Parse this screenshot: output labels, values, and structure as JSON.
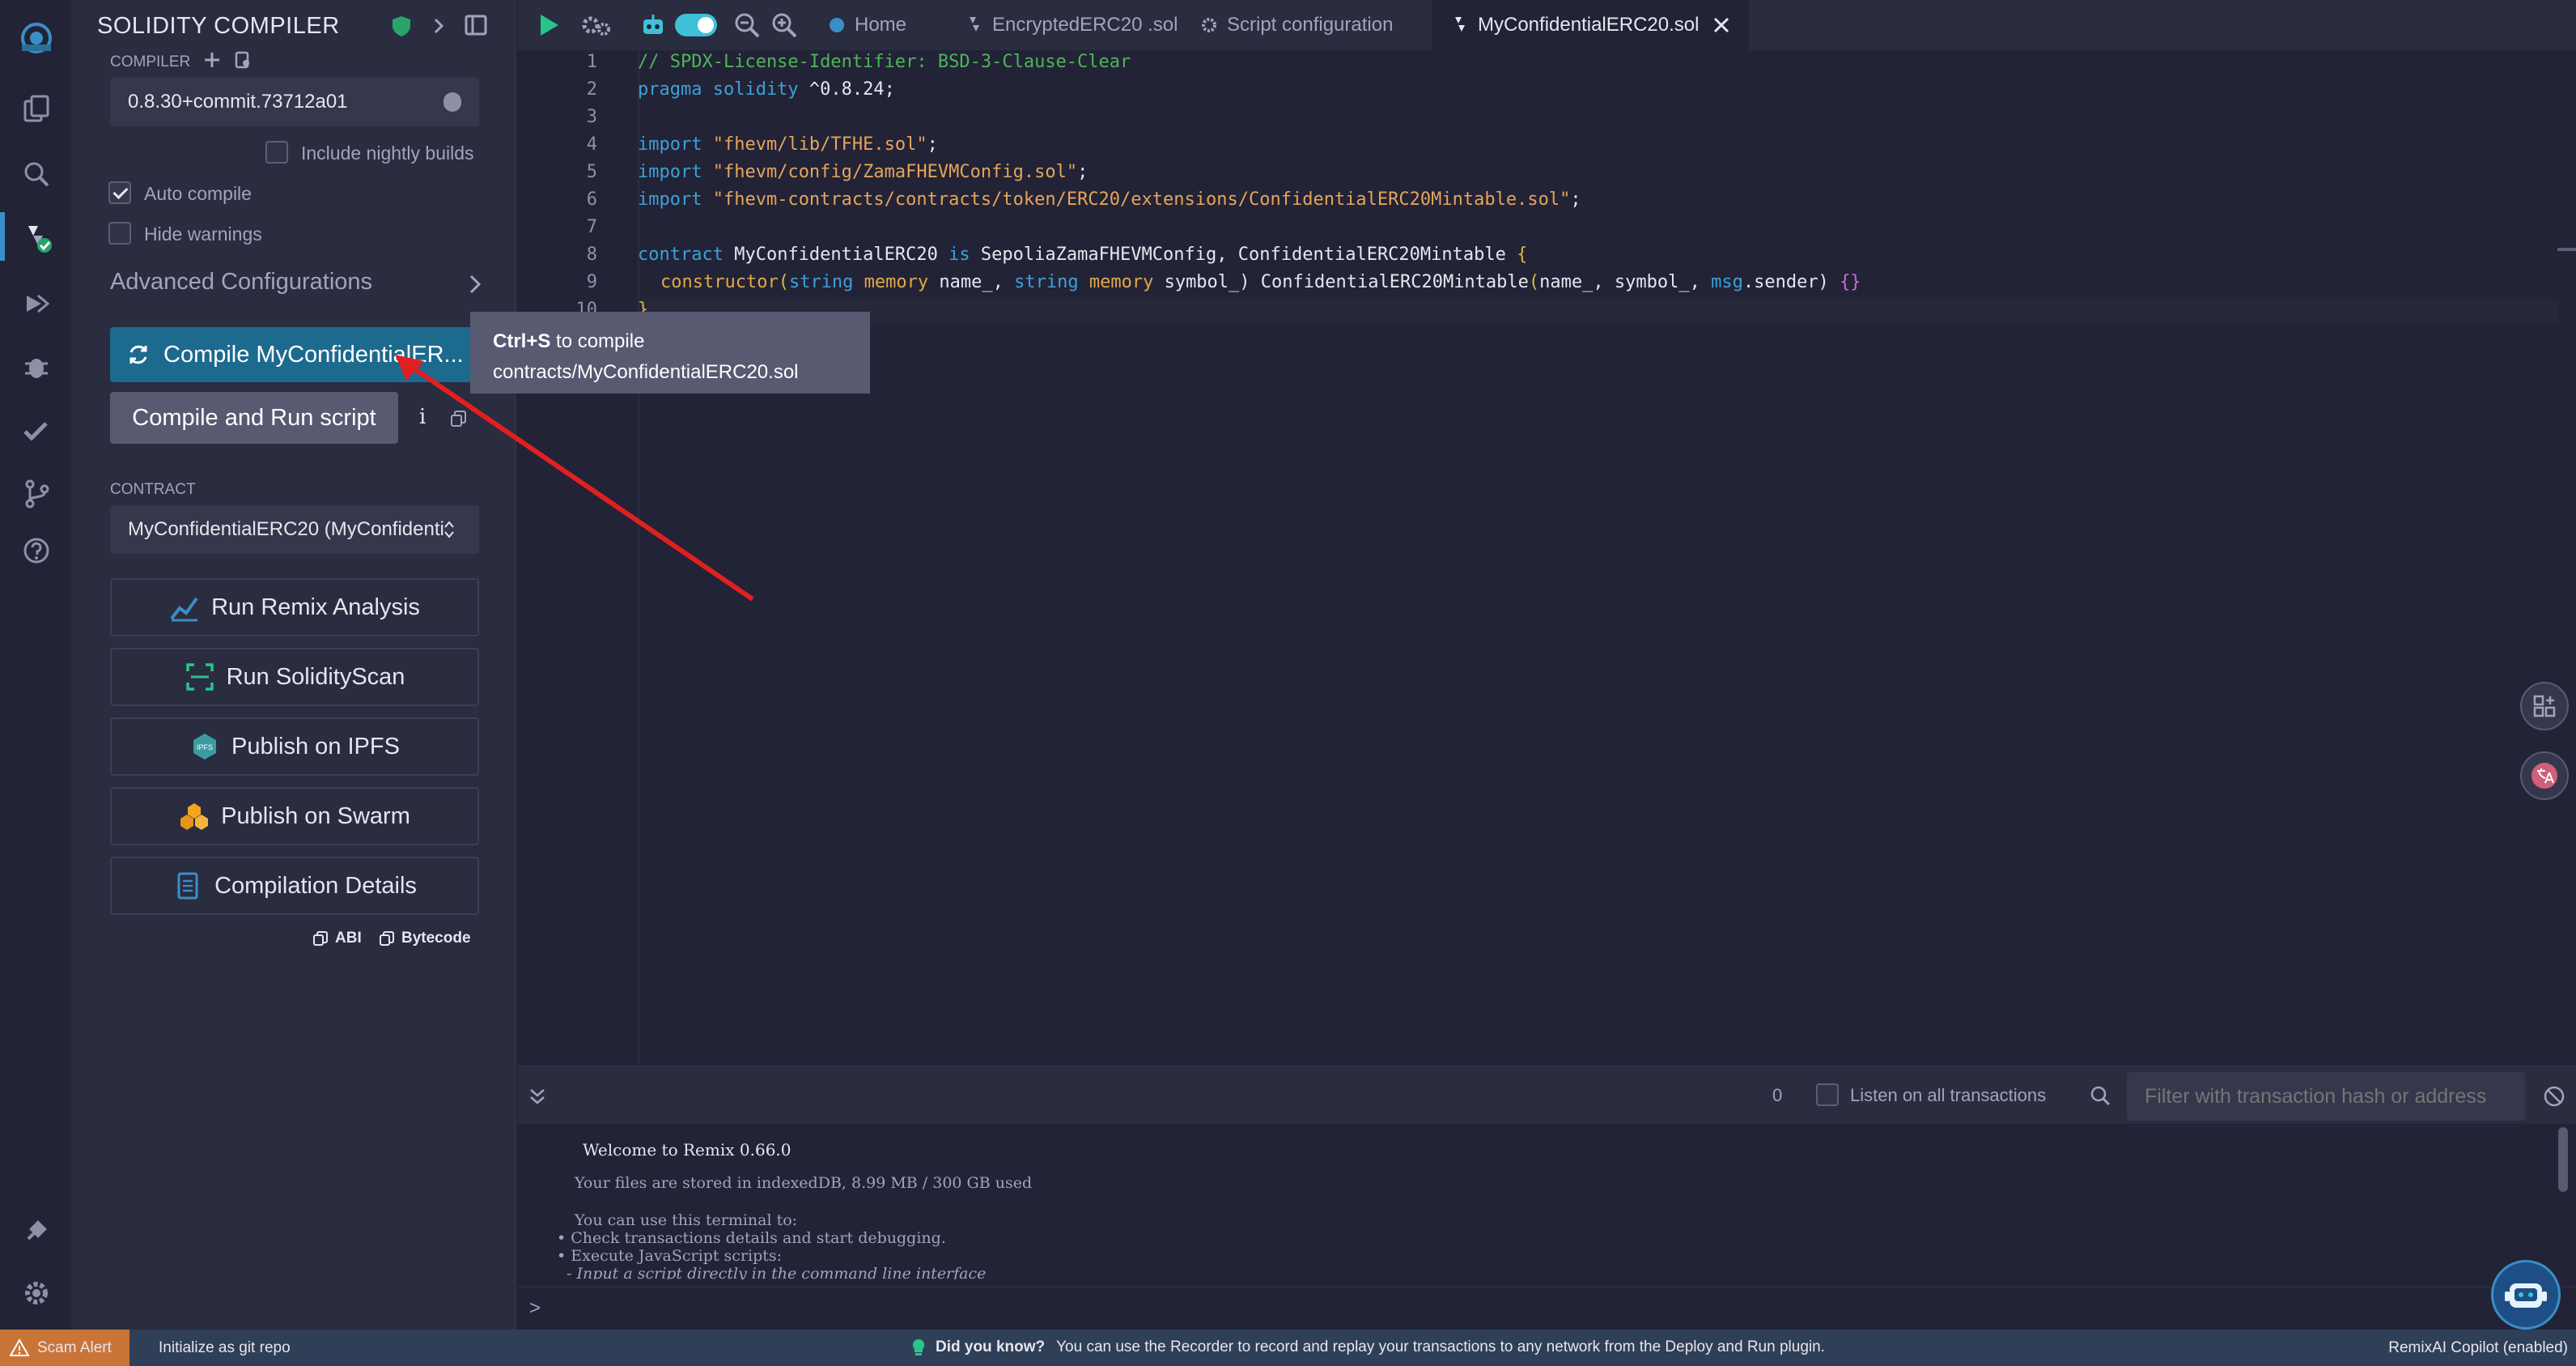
{
  "panel": {
    "title": "SOLIDITY COMPILER",
    "compiler_label": "COMPILER",
    "compiler_version": "0.8.30+commit.73712a01",
    "include_nightly": "Include nightly builds",
    "auto_compile": "Auto compile",
    "hide_warnings": "Hide warnings",
    "advanced": "Advanced Configurations",
    "compile_btn": "Compile MyConfidentialER...",
    "compile_run_btn": "Compile and Run script",
    "info_glyph": "i",
    "contract_label": "CONTRACT",
    "contract_value": "MyConfidentialERC20 (MyConfidenti",
    "run_analysis": "Run Remix Analysis",
    "run_scan": "Run SolidityScan",
    "publish_ipfs": "Publish on IPFS",
    "publish_swarm": "Publish on Swarm",
    "compilation_details": "Compilation Details",
    "abi": "ABI",
    "bytecode": "Bytecode",
    "ipfs_badge": "IPFS"
  },
  "tooltip": {
    "shortcut": "Ctrl+S",
    "line1_rest": " to compile",
    "line2": "contracts/MyConfidentialERC20.sol"
  },
  "tabs": {
    "home": "Home",
    "t1": "EncryptedERC20 .sol",
    "t2": "Script configuration",
    "t3": "MyConfidentialERC20.sol"
  },
  "editor": {
    "line_numbers": [
      "1",
      "2",
      "3",
      "4",
      "5",
      "6",
      "7",
      "8",
      "9",
      "10"
    ],
    "l1": "// SPDX-License-Identifier: BSD-3-Clause-Clear",
    "l2_kw": "pragma solidity",
    "l2_rest": " ^0.8.24;",
    "l4_kw": "import",
    "l4_str": " \"fhevm/lib/TFHE.sol\"",
    "l5_kw": "import",
    "l5_str": " \"fhevm/config/ZamaFHEVMConfig.sol\"",
    "l6_kw": "import",
    "l6_str": " \"fhevm-contracts/contracts/token/ERC20/extensions/ConfidentialERC20Mintable.sol\"",
    "semi": ";",
    "l8_kw": "contract",
    "l8_name": " MyConfidentialERC20 ",
    "l8_is": "is",
    "l8_rest": " SepoliaZamaFHEVMConfig, ConfidentialERC20Mintable ",
    "l8_brace": "{",
    "l9_ctor": "constructor",
    "l9_p1": "(",
    "l9_t1": "string",
    "l9_m1": " memory",
    "l9_a1": " name_, ",
    "l9_t2": "string",
    "l9_m2": " memory",
    "l9_a2": " symbol_) ConfidentialERC20Mintable",
    "l9_p2": "(",
    "l9_a3": "name_, symbol_, ",
    "l9_msg": "msg",
    "l9_end": ".sender) ",
    "l9_braces": "{}",
    "l10": "}"
  },
  "terminal": {
    "count": "0",
    "listen": "Listen on all transactions",
    "filter_placeholder": "Filter with transaction hash or address",
    "welcome": "Welcome to Remix 0.66.0",
    "storage": "Your files are stored in indexedDB, 8.99 MB / 300 GB used",
    "use_to": "You can use this terminal to:",
    "b1": "• Check transactions details and start debugging.",
    "b2": "• Execute JavaScript scripts:",
    "b3": "  - Input a script directly in the command line interface",
    "prompt": ">"
  },
  "status": {
    "scam": "Scam Alert",
    "git": "Initialize as git repo",
    "did_you_know": "Did you know?",
    "tip": "You can use the Recorder to record and replay your transactions to any network from the Deploy and Run plugin.",
    "copilot": "RemixAI Copilot (enabled)"
  },
  "colors": {
    "accent": "#2a6f97",
    "compile_btn": "#1d6a8f",
    "secondary_btn": "#585a72",
    "scam": "#c97539",
    "arrow": "#e02020"
  }
}
